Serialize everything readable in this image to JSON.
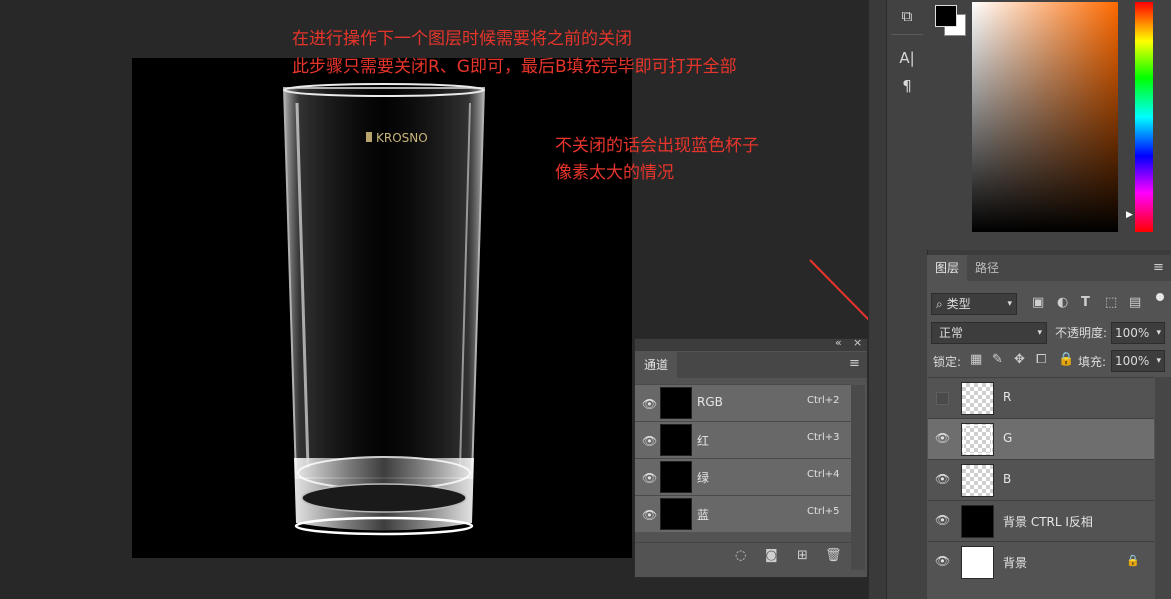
{
  "annotations": {
    "line1": "在进行操作下一个图层时候需要将之前的关闭",
    "line2": "此步骤只需要关闭R、G即可，最后B填充完毕即可打开全部",
    "line3": "不关闭的话会出现蓝色杯子",
    "line4": "像素太大的情况"
  },
  "document": {
    "brand_text": "KROSNO"
  },
  "tools": {
    "char_icon": "A|",
    "para_icon": "¶"
  },
  "layers_panel": {
    "tabs": [
      "图层",
      "路径"
    ],
    "filter_label": "类型",
    "blend_mode": "正常",
    "opacity_label": "不透明度:",
    "opacity_value": "100%",
    "lock_label": "锁定:",
    "fill_label": "填充:",
    "fill_value": "100%",
    "layers": [
      {
        "name": "R",
        "visible": false,
        "selected": false
      },
      {
        "name": "G",
        "visible": true,
        "selected": true
      },
      {
        "name": "B",
        "visible": true,
        "selected": false
      },
      {
        "name": "背景 CTRL I反相",
        "visible": true,
        "selected": false
      },
      {
        "name": "背景",
        "visible": true,
        "selected": false,
        "locked": true
      }
    ]
  },
  "channels_panel": {
    "title": "通道",
    "channels": [
      {
        "name": "RGB",
        "shortcut": "Ctrl+2"
      },
      {
        "name": "红",
        "shortcut": "Ctrl+3"
      },
      {
        "name": "绿",
        "shortcut": "Ctrl+4"
      },
      {
        "name": "蓝",
        "shortcut": "Ctrl+5"
      }
    ]
  },
  "colors": {
    "annotation": "#e8352b",
    "arrow": "#e8352b"
  }
}
